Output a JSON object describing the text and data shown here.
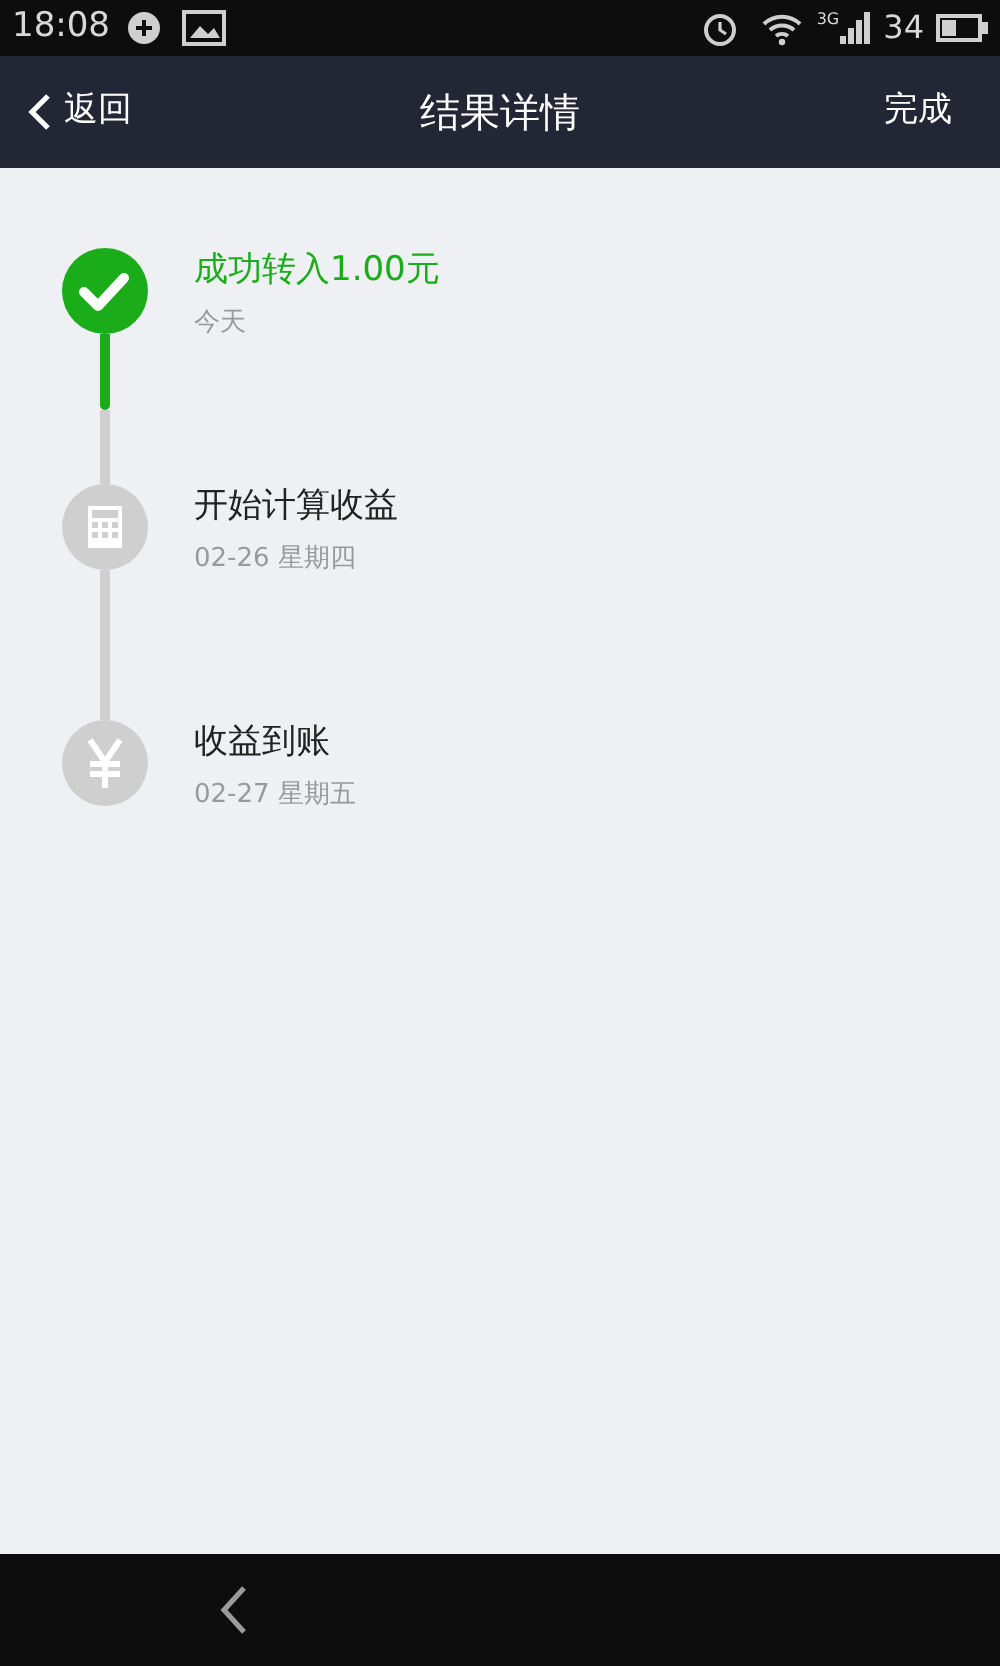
{
  "status_bar": {
    "time": "18:08",
    "network": "3G",
    "battery": "34"
  },
  "nav_bar": {
    "back": "返回",
    "title": "结果详情",
    "action": "完成"
  },
  "steps": [
    {
      "kind": "check",
      "title": "成功转入1.00元",
      "subtitle": "今天",
      "done": true
    },
    {
      "kind": "calculator",
      "title": "开始计算收益",
      "subtitle": "02-26 星期四",
      "done": false
    },
    {
      "kind": "yen",
      "title": "收益到账",
      "subtitle": "02-27 星期五",
      "done": false
    }
  ]
}
